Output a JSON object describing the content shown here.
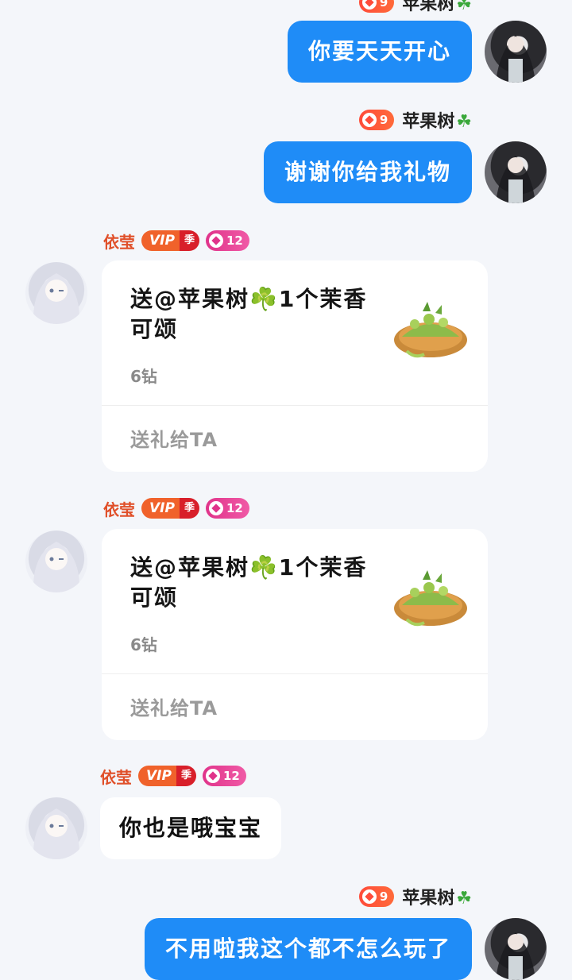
{
  "me": {
    "nickname": "苹果树",
    "level": "9"
  },
  "other": {
    "nickname": "依莹",
    "vip_label": "VIP",
    "vip_season": "季",
    "level": "12"
  },
  "messages": [
    {
      "text": "你要天天开心"
    },
    {
      "text": "谢谢你给我礼物"
    },
    {
      "gift_text": "送@苹果树☘️1个茉香可颂",
      "price": "6钻",
      "send_label": "送礼给TA"
    },
    {
      "gift_text": "送@苹果树☘️1个茉香可颂",
      "price": "6钻",
      "send_label": "送礼给TA"
    },
    {
      "text": "你也是哦宝宝"
    },
    {
      "text": "不用啦我这个都不怎么玩了"
    }
  ],
  "colors": {
    "my_bubble": "#1f8cf7",
    "other_nick": "#e0502a",
    "background": "#f4f6fa"
  }
}
